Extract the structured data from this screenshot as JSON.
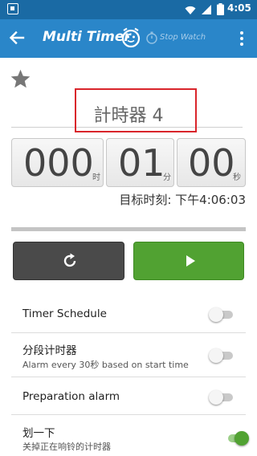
{
  "status_bar": {
    "time": "4:05",
    "icons": [
      "app-notification-icon",
      "wifi-icon",
      "signal-icon",
      "battery-icon"
    ]
  },
  "app_bar": {
    "title": "Multi Timer",
    "stopwatch_label": "Stop Watch",
    "color": "#2a86c9",
    "icons": [
      "back-arrow-icon",
      "timer-face-icon",
      "stopwatch-icon",
      "overflow-menu-icon"
    ]
  },
  "timer": {
    "favorite_icon": "star-icon",
    "name": "計時器 4",
    "hours": "000",
    "hours_unit": "时",
    "minutes": "01",
    "minutes_unit": "分",
    "seconds": "00",
    "seconds_unit": "秒",
    "target_time": "目标时刻: 下午4:06:03",
    "progress_fraction": 0,
    "highlight_color": "#d9252b"
  },
  "controls": {
    "reset_icon": "refresh-icon",
    "reset_color": "#4a4a4a",
    "start_icon": "play-icon",
    "start_color": "#51a232"
  },
  "settings": [
    {
      "title": "Timer Schedule",
      "subtitle": "",
      "enabled": false
    },
    {
      "title": "分段计时器",
      "subtitle": "Alarm every 30秒 based on start time",
      "enabled": false
    },
    {
      "title": "Preparation alarm",
      "subtitle": "",
      "enabled": false
    },
    {
      "title": "划一下",
      "subtitle": "关掉正在响铃的计时器",
      "enabled": true
    }
  ]
}
